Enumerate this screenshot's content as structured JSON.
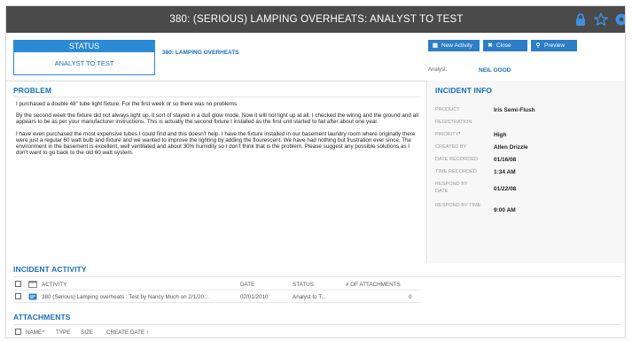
{
  "window": {
    "title": "380: (SERIOUS) LAMPING OVERHEATS: ANALYST TO TEST"
  },
  "status": {
    "header": "STATUS",
    "value": "ANALYST TO TEST"
  },
  "breadcrumb": "380: LAMPING OVERHEATS",
  "actions": {
    "new_activity": "New Activity",
    "close": "Close",
    "preview": "Preview"
  },
  "analyst": {
    "label": "Analyst:",
    "value": "NEIL GOOD"
  },
  "problem": {
    "title": "PROBLEM",
    "paragraphs": [
      "I purchased a double 48\" tube light fixture. For the first week or so there was no problems.",
      "By the second week the fixture did not always light up, it sort of stayed in a dull glow mode. Now it will not light up at all. I checked the wiring and the ground and all appears to be as per your manufacturer instructions. This is actually the second fixture I installed as the first unit started to fail after about one year.",
      "I have even purchased the most expensive tubes I could find and this doesn't help. I have the fixture installed in our basement laundry room where originally there were just a regular 60 watt bulb and fixture and we wanted to improve the lighting by adding the flourescent. We have had nothing but frustration ever since. The environment in the basement is excellent, well ventilated and about 30% humidity so I don't think that is the problem. Please suggest any possible solutions as I don't want to go back to the old 60 watt system."
    ]
  },
  "incident_info": {
    "title": "INCIDENT INFO",
    "rows": [
      {
        "label": "PRODUCT",
        "value": "Iris Semi-Flush"
      },
      {
        "label": "REGISTRATION",
        "value": ""
      },
      {
        "label": "PRIORITY",
        "req": "*",
        "value": "High"
      },
      {
        "label": "CREATED BY",
        "value": "Allen Drizzle"
      },
      {
        "label": "DATE RECORDED",
        "value": "01/16/08"
      },
      {
        "label": "TIME RECORDED",
        "value": "1:34 AM"
      },
      {
        "label": "RESPOND BY DATE",
        "value": "01/22/08"
      },
      {
        "label": "RESPOND BY TIME",
        "value": "9:00 AM"
      }
    ]
  },
  "activity": {
    "title": "INCIDENT ACTIVITY",
    "columns": {
      "activity": "ACTIVITY",
      "date": "DATE",
      "status": "STATUS",
      "attachments": "# OF ATTACHMENTS"
    },
    "rows": [
      {
        "activity": "380 (Serious) Lamping overheats : Test by Nancy Much on 2/1/20...",
        "date": "02/01/2010",
        "status": "Analyst to T...",
        "attachments": "0"
      }
    ]
  },
  "attachments": {
    "title": "ATTACHMENTS",
    "columns": {
      "name": "NAME",
      "name_sort": "^",
      "type": "TYPE",
      "size": "SIZE",
      "create_date": "CREATE DATE",
      "create_date_sort": "↑"
    }
  },
  "colors": {
    "title_bar": "#4a4a4a",
    "accent_blue": "#2b8ad3",
    "link_blue": "#1a6fb7",
    "required_red": "#d9322b"
  },
  "icons": {
    "title_bar": [
      "lock-icon",
      "star-icon",
      "gear-icon"
    ],
    "buttons": [
      "grid-plus-icon",
      "x-icon",
      "magnifier-icon"
    ]
  }
}
